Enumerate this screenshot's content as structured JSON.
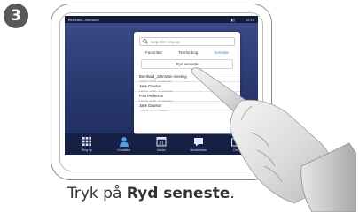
{
  "step": {
    "number": "3"
  },
  "screen": {
    "status": {
      "user": "Bernhard Johnsson",
      "clock": "12:14"
    },
    "popup": {
      "search_placeholder": "Søg eller ring op",
      "tabs": [
        {
          "label": "Favoritter"
        },
        {
          "label": "Telefonbog"
        },
        {
          "label": "Seneste"
        }
      ],
      "recent_button": "Ryd seneste",
      "items": [
        {
          "title": "Bernhard_Johnsson meeting",
          "sub": "I dag kl. 12:14 · 6 sekunder"
        },
        {
          "title": "Jane Dawson",
          "sub": "I dag kl. 12:12 · 32 sekunder"
        },
        {
          "title": "Frits Pedersen",
          "sub": "I dag kl. 11:08 · 17 sekunder"
        },
        {
          "title": "Jane Dawson",
          "sub": "I dag kl. 10:05 · 1 sekund"
        }
      ]
    },
    "dock": [
      {
        "label": "Ring op"
      },
      {
        "label": "Kontakter"
      },
      {
        "label": "Møder"
      },
      {
        "label": "Meddelelser"
      },
      {
        "label": "Del"
      }
    ]
  },
  "caption": {
    "prefix": "Tryk på ",
    "bold": "Ryd seneste",
    "suffix": "."
  },
  "colors": {
    "accent": "#2a89d6",
    "screen_bg": "#2c3b74",
    "badge": "#595959"
  },
  "icons": [
    "search-icon",
    "keypad-icon",
    "contact-icon",
    "calendar-icon",
    "messages-icon",
    "share-icon",
    "pointing-hand-icon"
  ]
}
